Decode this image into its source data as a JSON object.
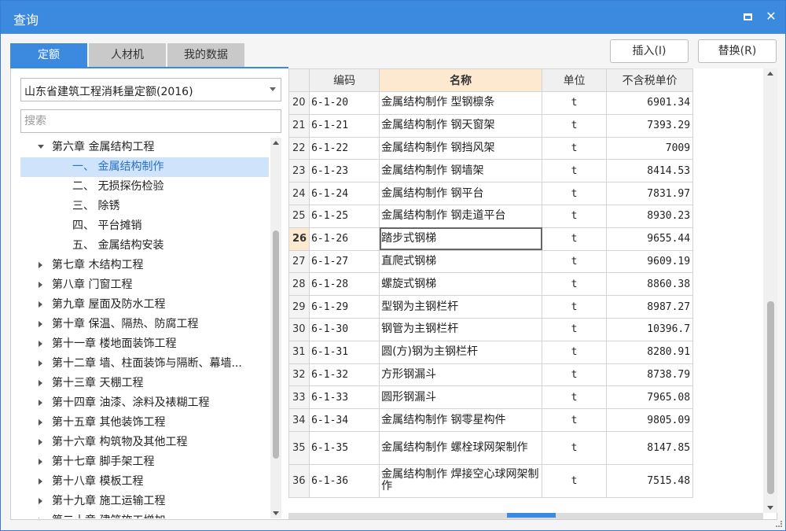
{
  "window": {
    "title": "查询"
  },
  "tabs": [
    "定额",
    "人材机",
    "我的数据"
  ],
  "buttons": {
    "insert": "插入(I)",
    "replace": "替换(R)"
  },
  "quota_select": {
    "value": "山东省建筑工程消耗量定额(2016)"
  },
  "search": {
    "placeholder": "搜索"
  },
  "tree": [
    {
      "label": "第六章 金属结构工程",
      "level": 0,
      "expanded": true
    },
    {
      "label": "一、 金属结构制作",
      "level": 1,
      "selected": true
    },
    {
      "label": "二、 无损探伤检验",
      "level": 1
    },
    {
      "label": "三、 除锈",
      "level": 1
    },
    {
      "label": "四、 平台摊销",
      "level": 1
    },
    {
      "label": "五、 金属结构安装",
      "level": 1
    },
    {
      "label": "第七章 木结构工程",
      "level": 0
    },
    {
      "label": "第八章 门窗工程",
      "level": 0
    },
    {
      "label": "第九章 屋面及防水工程",
      "level": 0
    },
    {
      "label": "第十章 保温、隔热、防腐工程",
      "level": 0
    },
    {
      "label": "第十一章 楼地面装饰工程",
      "level": 0
    },
    {
      "label": "第十二章 墙、柱面装饰与隔断、幕墙...",
      "level": 0
    },
    {
      "label": "第十三章 天棚工程",
      "level": 0
    },
    {
      "label": "第十四章 油漆、涂料及裱糊工程",
      "level": 0
    },
    {
      "label": "第十五章 其他装饰工程",
      "level": 0
    },
    {
      "label": "第十六章 构筑物及其他工程",
      "level": 0
    },
    {
      "label": "第十七章 脚手架工程",
      "level": 0
    },
    {
      "label": "第十八章 模板工程",
      "level": 0
    },
    {
      "label": "第十九章 施工运输工程",
      "level": 0
    },
    {
      "label": "第二十章 建筑施工增加",
      "level": 0
    }
  ],
  "grid": {
    "headers": {
      "code": "编码",
      "name": "名称",
      "unit": "单位",
      "price": "不含税单价"
    },
    "current_row": "26",
    "rows": [
      {
        "n": "20",
        "code": "6-1-20",
        "name": "金属结构制作 型钢檩条",
        "unit": "t",
        "price": "6901.34"
      },
      {
        "n": "21",
        "code": "6-1-21",
        "name": "金属结构制作 钢天窗架",
        "unit": "t",
        "price": "7393.29"
      },
      {
        "n": "22",
        "code": "6-1-22",
        "name": "金属结构制作 钢挡风架",
        "unit": "t",
        "price": "7009"
      },
      {
        "n": "23",
        "code": "6-1-23",
        "name": "金属结构制作 钢墙架",
        "unit": "t",
        "price": "8414.53"
      },
      {
        "n": "24",
        "code": "6-1-24",
        "name": "金属结构制作 钢平台",
        "unit": "t",
        "price": "7831.97"
      },
      {
        "n": "25",
        "code": "6-1-25",
        "name": "金属结构制作 钢走道平台",
        "unit": "t",
        "price": "8930.23"
      },
      {
        "n": "26",
        "code": "6-1-26",
        "name": "踏步式钢梯",
        "unit": "t",
        "price": "9655.44"
      },
      {
        "n": "27",
        "code": "6-1-27",
        "name": "直爬式钢梯",
        "unit": "t",
        "price": "9609.19"
      },
      {
        "n": "28",
        "code": "6-1-28",
        "name": "螺旋式钢梯",
        "unit": "t",
        "price": "8860.38"
      },
      {
        "n": "29",
        "code": "6-1-29",
        "name": "型钢为主钢栏杆",
        "unit": "t",
        "price": "8987.27"
      },
      {
        "n": "30",
        "code": "6-1-30",
        "name": "钢管为主钢栏杆",
        "unit": "t",
        "price": "10396.7"
      },
      {
        "n": "31",
        "code": "6-1-31",
        "name": "圆(方)钢为主钢栏杆",
        "unit": "t",
        "price": "8280.91"
      },
      {
        "n": "32",
        "code": "6-1-32",
        "name": "方形钢漏斗",
        "unit": "t",
        "price": "8738.79"
      },
      {
        "n": "33",
        "code": "6-1-33",
        "name": "圆形钢漏斗",
        "unit": "t",
        "price": "7965.08"
      },
      {
        "n": "34",
        "code": "6-1-34",
        "name": "金属结构制作 钢零星构件",
        "unit": "t",
        "price": "9805.09"
      },
      {
        "n": "35",
        "code": "6-1-35",
        "name": "金属结构制作 螺栓球网架制作",
        "unit": "t",
        "price": "8147.85"
      },
      {
        "n": "36",
        "code": "6-1-36",
        "name": "金属结构制作 焊接空心球网架制作",
        "unit": "t",
        "price": "7515.48"
      }
    ]
  }
}
